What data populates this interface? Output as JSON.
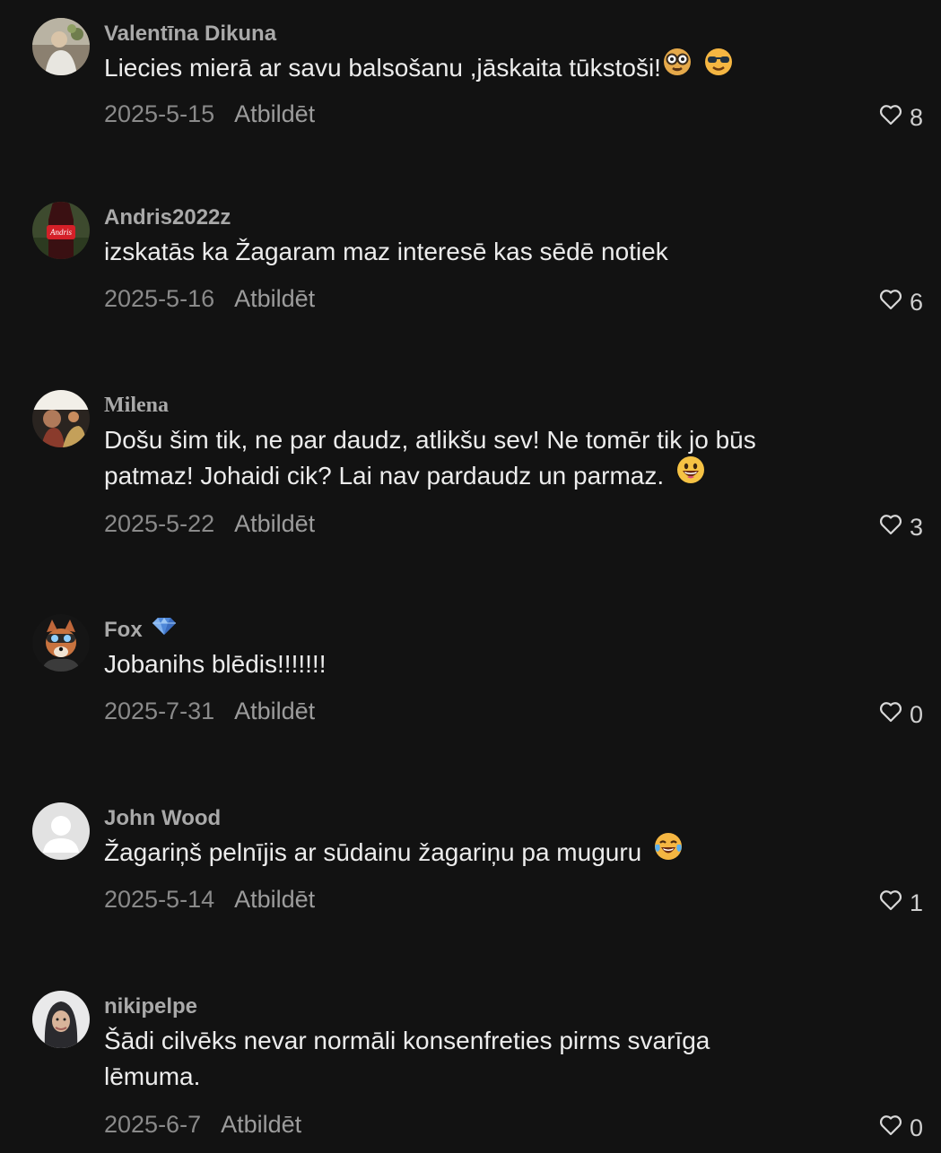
{
  "comments": [
    {
      "username": "Valentīna Dikuna",
      "text_lines": [
        "Liecies mierā ar savu balsošanu ,jāskaita tūkstoši!"
      ],
      "emojis": [
        "nerd-face-emoji",
        "sunglasses-face-emoji"
      ],
      "date": "2025-5-15",
      "reply_label": "Atbildēt",
      "likes": "8"
    },
    {
      "username": "Andris2022z",
      "text_lines": [
        "izskatās ka Žagaram maz interesē kas sēdē notiek"
      ],
      "emojis": [],
      "date": "2025-5-16",
      "reply_label": "Atbildēt",
      "likes": "6"
    },
    {
      "username": "Milena",
      "text_lines": [
        "Došu šim tik, ne par daudz, atlikšu sev! Ne tomēr tik jo būs",
        "patmaz! Johaidi cik? Lai nav pardaudz un parmaz."
      ],
      "emojis": [
        "grinning-face-emoji"
      ],
      "date": "2025-5-22",
      "reply_label": "Atbildēt",
      "likes": "3"
    },
    {
      "username": "Fox",
      "badge": "diamond-badge-icon",
      "text_lines": [
        "Jobanihs blēdis!!!!!!!"
      ],
      "emojis": [],
      "date": "2025-7-31",
      "reply_label": "Atbildēt",
      "likes": "0"
    },
    {
      "username": "John Wood",
      "text_lines": [
        "Žagariņš pelnījis ar sūdainu žagariņu pa muguru"
      ],
      "emojis": [
        "tears-of-joy-emoji"
      ],
      "date": "2025-5-14",
      "reply_label": "Atbildēt",
      "likes": "1"
    },
    {
      "username": "nikipelpe",
      "text_lines": [
        "Šādi cilvēks nevar normāli konsenfreties pirms svarīga",
        "lēmuma."
      ],
      "emojis": [],
      "date": "2025-6-7",
      "reply_label": "Atbildēt",
      "likes": "0"
    }
  ],
  "colors": {
    "background": "#121212",
    "username": "#a9a9a9",
    "text": "#ececec",
    "meta": "#8a8a8a"
  }
}
